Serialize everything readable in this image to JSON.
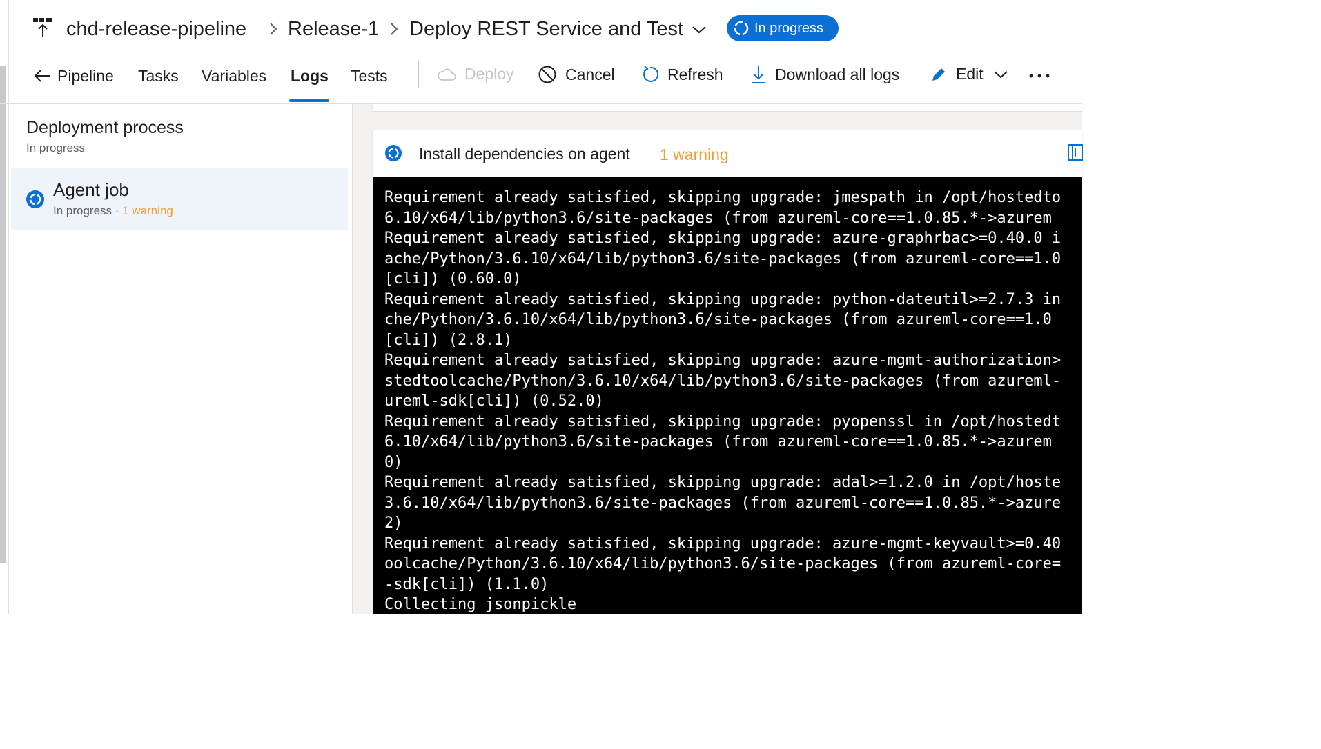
{
  "breadcrumb": {
    "pipeline": "chd-release-pipeline",
    "release": "Release-1",
    "stage": "Deploy REST Service and Test",
    "status": "In progress"
  },
  "tabs": [
    {
      "label": "Pipeline"
    },
    {
      "label": "Tasks"
    },
    {
      "label": "Variables"
    },
    {
      "label": "Logs",
      "active": true
    },
    {
      "label": "Tests"
    }
  ],
  "toolbar": {
    "deploy": "Deploy",
    "cancel": "Cancel",
    "refresh": "Refresh",
    "download": "Download all logs",
    "edit": "Edit"
  },
  "left_panel": {
    "title": "Deployment process",
    "status": "In progress",
    "job": {
      "title": "Agent job",
      "status": "In progress",
      "separator": " · ",
      "warning": "1 warning"
    }
  },
  "task": {
    "title": "Install dependencies on agent",
    "warning": "1 warning"
  },
  "log": {
    "lines": [
      "Requirement already satisfied, skipping upgrade: jmespath in /opt/hostedto",
      "6.10/x64/lib/python3.6/site-packages (from azureml-core==1.0.85.*->azurem",
      "Requirement already satisfied, skipping upgrade: azure-graphrbac>=0.40.0 i",
      "ache/Python/3.6.10/x64/lib/python3.6/site-packages (from azureml-core==1.0",
      "[cli]) (0.60.0)",
      "Requirement already satisfied, skipping upgrade: python-dateutil>=2.7.3 in",
      "che/Python/3.6.10/x64/lib/python3.6/site-packages (from azureml-core==1.0",
      "[cli]) (2.8.1)",
      "Requirement already satisfied, skipping upgrade: azure-mgmt-authorization>",
      "stedtoolcache/Python/3.6.10/x64/lib/python3.6/site-packages (from azureml-",
      "ureml-sdk[cli]) (0.52.0)",
      "Requirement already satisfied, skipping upgrade: pyopenssl in /opt/hostedt",
      "6.10/x64/lib/python3.6/site-packages (from azureml-core==1.0.85.*->azurem",
      "0)",
      "Requirement already satisfied, skipping upgrade: adal>=1.2.0 in /opt/hoste",
      "3.6.10/x64/lib/python3.6/site-packages (from azureml-core==1.0.85.*->azure",
      "2)",
      "Requirement already satisfied, skipping upgrade: azure-mgmt-keyvault>=0.40",
      "oolcache/Python/3.6.10/x64/lib/python3.6/site-packages (from azureml-core=",
      "-sdk[cli]) (1.1.0)",
      "Collecting jsonpickle"
    ]
  },
  "colors": {
    "accent": "#0b6fd6",
    "warning": "#e8a13a",
    "selected_row": "#eff4fb"
  },
  "icons": [
    "pipeline-icon",
    "chevron-right-icon",
    "chevron-down-icon",
    "in-progress-icon",
    "arrow-left-icon",
    "cloud-icon",
    "cancel-icon",
    "refresh-icon",
    "download-icon",
    "pencil-icon",
    "more-icon",
    "expand-icon"
  ]
}
